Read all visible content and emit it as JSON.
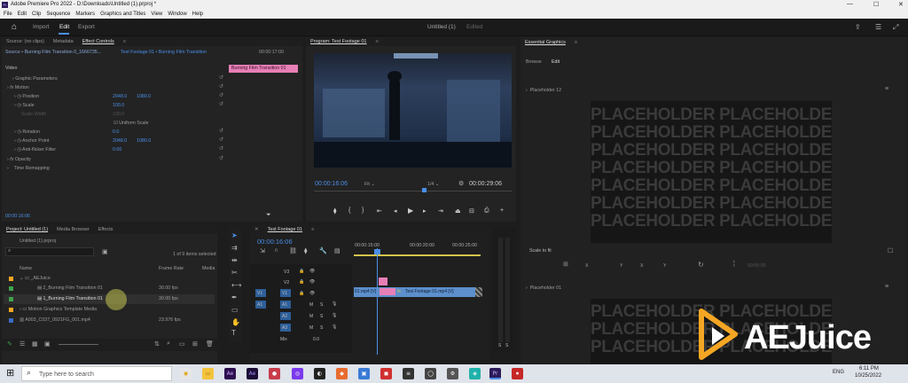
{
  "window": {
    "title": "Adobe Premiere Pro 2022 - D:\\Downloads\\Untitled (1).prproj *"
  },
  "menu": [
    "File",
    "Edit",
    "Clip",
    "Sequence",
    "Markers",
    "Graphics and Titles",
    "View",
    "Window",
    "Help"
  ],
  "appbar": {
    "tabs": [
      "Import",
      "Edit",
      "Export"
    ],
    "project_title": "Untitled (1)",
    "status": "Edited"
  },
  "effect_controls": {
    "tabs": [
      "Source: (no clips)",
      "Metadata",
      "Effect Controls"
    ],
    "source_label": "Source • Burning Film Transition 0_1666735...",
    "clip_label": "Test Footage 01 • Burning Film Transition",
    "ruler_time": "00:00:17:00",
    "clip_bar": "Burning Film Transition 01",
    "section_video": "Video",
    "rows": [
      {
        "label": "Graphic Parameters"
      },
      {
        "label": "Motion"
      },
      {
        "label": "Position",
        "v1": "2048.0",
        "v2": "1080.0"
      },
      {
        "label": "Scale",
        "v1": "100.0"
      },
      {
        "label": "Scale Width",
        "v1": "100.0"
      },
      {
        "label": "Uniform Scale"
      },
      {
        "label": "Rotation",
        "v1": "0.0"
      },
      {
        "label": "Anchor Point",
        "v1": "2048.0",
        "v2": "1080.0"
      },
      {
        "label": "Anti-flicker Filter",
        "v1": "0.00"
      },
      {
        "label": "Opacity"
      },
      {
        "label": "Time Remapping"
      }
    ],
    "timecode": "00:00:16:06"
  },
  "program": {
    "tab": "Program: Test Footage 01",
    "timecode": "00:00:16:06",
    "fit": "Fit",
    "quality": "1/4",
    "duration": "00:00:29:06"
  },
  "essential_graphics": {
    "tab": "Essential Graphics",
    "subtabs": [
      "Browse",
      "Edit"
    ],
    "placeholder_top": "Placeholder 12",
    "placeholder_bottom": "Placeholder 01",
    "placeholder_word": "PLACEHOLDER PLACEHOLDER PLACEHOLDER",
    "scale_to_fit": "Scale to fit",
    "transform": [
      "X",
      "Y",
      "W",
      "X",
      "Y",
      "00:00:00"
    ]
  },
  "project": {
    "tabs": [
      "Project: Untitled (1)",
      "Media Browser",
      "Effects"
    ],
    "file": "Untitled (1).prproj",
    "selected": "1 of 9 items selected",
    "col_name": "Name",
    "col_rate": "Frame Rate",
    "col_media": "Media",
    "items": [
      {
        "name": "_AEJuice",
        "rate": ""
      },
      {
        "name": "2_Burning Film Transition 01",
        "rate": "30.00 fps"
      },
      {
        "name": "1_Burning Film Transition 01",
        "rate": "30.00 fps"
      },
      {
        "name": "Motion Graphics Template Media",
        "rate": ""
      },
      {
        "name": "A003_C037_0921FG_001.mp4",
        "rate": "23.976 fps"
      }
    ]
  },
  "timeline": {
    "tab": "Test Footage 01",
    "timecode": "00:00:16:06",
    "ruler": [
      "00:00:15:00",
      "00:00:20:00",
      "00:00:25:00"
    ],
    "tracks_video": [
      "V3",
      "V2",
      "V1"
    ],
    "tracks_audio": [
      "A1",
      "A2",
      "A3"
    ],
    "mix": "Mix",
    "mix_value": "0.0",
    "clip1": "01.mp4 [V]",
    "clip_fx": "fx",
    "clip2": "Test Footage 01.mp4 [V]",
    "source_patch": [
      "V1",
      "A1"
    ]
  },
  "audio_meter": {
    "labels": [
      "S",
      "S"
    ]
  },
  "watermark": {
    "text": "AEJuice"
  },
  "taskbar": {
    "search_placeholder": "Type here to search",
    "time": "6:11 PM",
    "date": "10/25/2022",
    "lang": "ENG"
  }
}
